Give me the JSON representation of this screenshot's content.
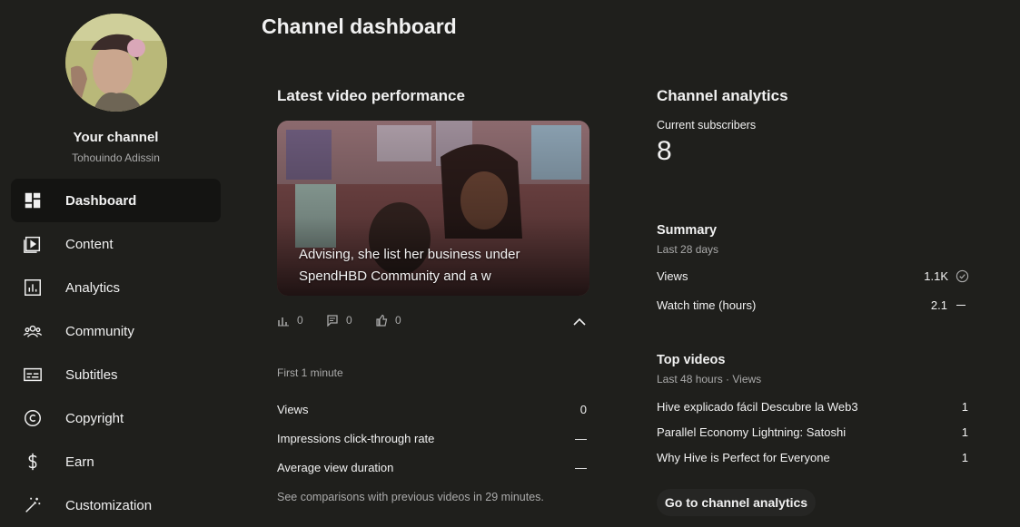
{
  "sidebar": {
    "channel_title": "Your channel",
    "channel_name": "Tohouindo Adissin",
    "items": [
      {
        "label": "Dashboard"
      },
      {
        "label": "Content"
      },
      {
        "label": "Analytics"
      },
      {
        "label": "Community"
      },
      {
        "label": "Subtitles"
      },
      {
        "label": "Copyright"
      },
      {
        "label": "Earn"
      },
      {
        "label": "Customization"
      }
    ]
  },
  "main": {
    "page_title": "Channel dashboard",
    "latest_video": {
      "section_title": "Latest video performance",
      "title": "Advising, she list her business under SpendHBD Community and a w",
      "views": "0",
      "comments": "0",
      "likes": "0",
      "period": "First 1 minute",
      "metrics": [
        {
          "label": "Views",
          "value": "0"
        },
        {
          "label": "Impressions click-through rate",
          "value": "—"
        },
        {
          "label": "Average view duration",
          "value": "—"
        }
      ],
      "note": "See comparisons with previous videos in 29 minutes."
    },
    "analytics": {
      "section_title": "Channel analytics",
      "subscribers_label": "Current subscribers",
      "subscribers_value": "8",
      "summary_title": "Summary",
      "summary_period": "Last 28 days",
      "summary_rows": [
        {
          "label": "Views",
          "value": "1.1K"
        },
        {
          "label": "Watch time (hours)",
          "value": "2.1"
        }
      ],
      "top_title": "Top videos",
      "top_period": "Last 48 hours · Views",
      "top_videos": [
        {
          "title": "Hive explicado fácil Descubre la Web3",
          "views": "1"
        },
        {
          "title": "Parallel Economy Lightning: Satoshi",
          "views": "1"
        },
        {
          "title": "Why Hive is Perfect for Everyone",
          "views": "1"
        }
      ],
      "button_label": "Go to channel analytics"
    }
  }
}
